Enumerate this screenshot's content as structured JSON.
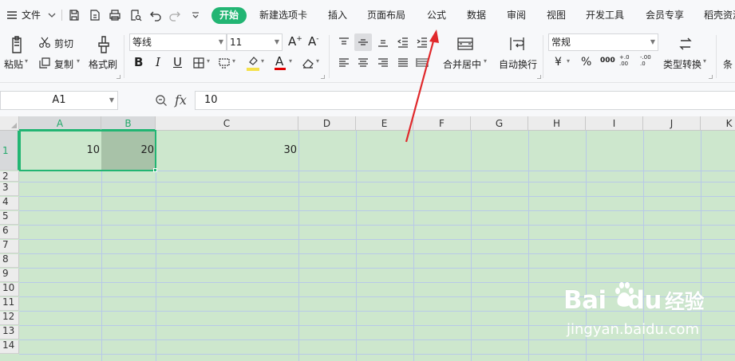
{
  "menu": {
    "file_label": "文件",
    "tabs": [
      {
        "label": "开始",
        "active": true
      },
      {
        "label": "新建选项卡",
        "active": false
      },
      {
        "label": "插入",
        "active": false
      },
      {
        "label": "页面布局",
        "active": false
      },
      {
        "label": "公式",
        "active": false
      },
      {
        "label": "数据",
        "active": false
      },
      {
        "label": "审阅",
        "active": false
      },
      {
        "label": "视图",
        "active": false
      },
      {
        "label": "开发工具",
        "active": false
      },
      {
        "label": "会员专享",
        "active": false
      },
      {
        "label": "稻壳资源",
        "active": false
      }
    ],
    "accent_color": "#22b573"
  },
  "ribbon": {
    "paste_label": "粘贴",
    "cut_label": "剪切",
    "copy_label": "复制",
    "format_painter_label": "格式刷",
    "font_name": "等线",
    "font_size": "11",
    "merge_label": "合并居中",
    "wrap_label": "自动换行",
    "number_format": "常规",
    "type_convert_label": "类型转换",
    "cond_label": "条",
    "bold_label": "B",
    "italic_label": "I",
    "underline_label": "U",
    "font_color_label": "A",
    "percent_label": "%",
    "thousands_label": "000",
    "currency_label": "¥",
    "dec_inc_label": "+.0 .00",
    "dec_dec_label": "-.00 .0",
    "font_color": "#e00000",
    "fill_color": "#f5e14a"
  },
  "formula_bar": {
    "name_box": "A1",
    "fx_label": "fx",
    "value": "10"
  },
  "grid": {
    "columns": [
      "A",
      "B",
      "C",
      "D",
      "E",
      "F",
      "G",
      "H",
      "I",
      "J",
      "K"
    ],
    "rows": [
      "1",
      "2",
      "3",
      "4",
      "5",
      "6",
      "7",
      "8",
      "9",
      "10",
      "11",
      "12",
      "13",
      "14"
    ],
    "cells": {
      "A1": "10",
      "B1": "20",
      "C1": "30"
    },
    "selected_range": "A1:B1",
    "background_color": "#cde7cd"
  },
  "watermark": {
    "brand": "Bai",
    "brand2": "du",
    "brand_cn": "经验",
    "url": "jingyan.baidu.com"
  }
}
